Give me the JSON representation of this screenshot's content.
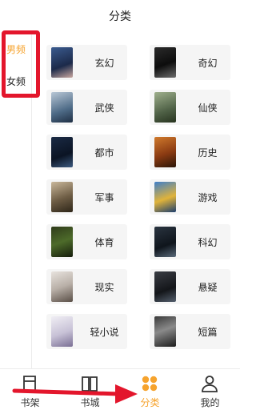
{
  "header": {
    "title": "分类"
  },
  "sidebar": {
    "items": [
      {
        "label": "男频",
        "active": true
      },
      {
        "label": "女频",
        "active": false
      }
    ]
  },
  "categories": [
    {
      "label": "玄幻",
      "cover_text": ""
    },
    {
      "label": "奇幻",
      "cover_text": ""
    },
    {
      "label": "武侠",
      "cover_text": ""
    },
    {
      "label": "仙侠",
      "cover_text": ""
    },
    {
      "label": "都市",
      "cover_text": ""
    },
    {
      "label": "历史",
      "cover_text": ""
    },
    {
      "label": "军事",
      "cover_text": ""
    },
    {
      "label": "游戏",
      "cover_text": ""
    },
    {
      "label": "体育",
      "cover_text": ""
    },
    {
      "label": "科幻",
      "cover_text": ""
    },
    {
      "label": "现实",
      "cover_text": ""
    },
    {
      "label": "悬疑",
      "cover_text": ""
    },
    {
      "label": "轻小说",
      "cover_text": ""
    },
    {
      "label": "短篇",
      "cover_text": ""
    }
  ],
  "tabbar": {
    "tabs": [
      {
        "label": "书架",
        "icon": "bookshelf-icon",
        "active": false
      },
      {
        "label": "书城",
        "icon": "book-open-icon",
        "active": false
      },
      {
        "label": "分类",
        "icon": "category-grid-icon",
        "active": true
      },
      {
        "label": "我的",
        "icon": "person-icon",
        "active": false
      }
    ]
  },
  "colors": {
    "accent": "#f6a32d",
    "annotation_red": "#e3162c",
    "card_bg": "#f5f5f5"
  }
}
